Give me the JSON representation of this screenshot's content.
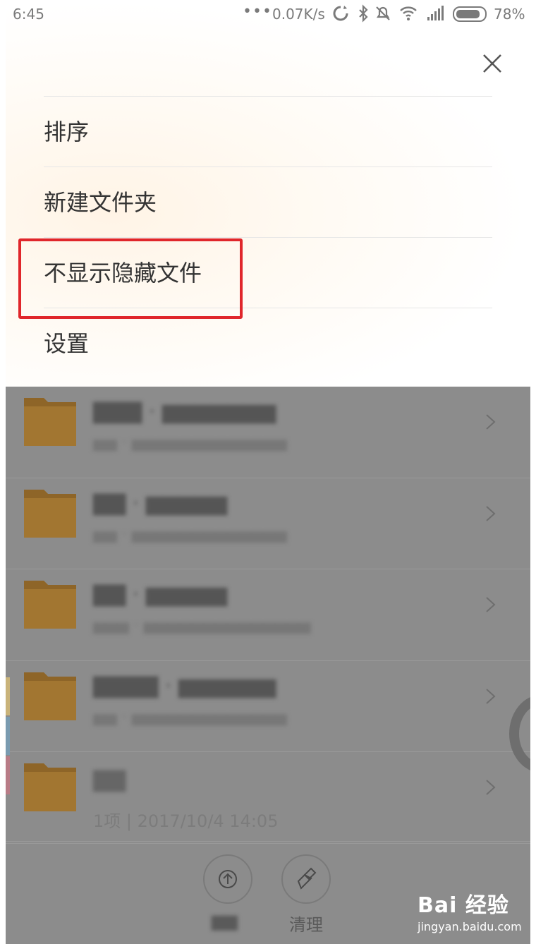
{
  "status_bar": {
    "time": "6:45",
    "dots": "•••",
    "network_speed": "0.07K/s",
    "battery_pct": "78%"
  },
  "menu": {
    "items": [
      {
        "label": "排序"
      },
      {
        "label": "新建文件夹"
      },
      {
        "label": "不显示隐藏文件"
      },
      {
        "label": "设置"
      }
    ]
  },
  "file_list": {
    "rows": [
      {
        "icon": "folder-icon"
      },
      {
        "icon": "folder-icon"
      },
      {
        "icon": "folder-icon"
      },
      {
        "icon": "folder-icon"
      },
      {
        "icon": "folder-icon",
        "meta": "1项 | 2017/10/4 14:05"
      }
    ]
  },
  "bottom_bar": {
    "clean_label": "清理"
  },
  "watermark": {
    "brand": "Bai 经验",
    "url": "jingyan.baidu.com"
  },
  "colors": {
    "highlight": "#e0262b",
    "folder": "#a27631",
    "overlay": "#8c8c8c"
  }
}
